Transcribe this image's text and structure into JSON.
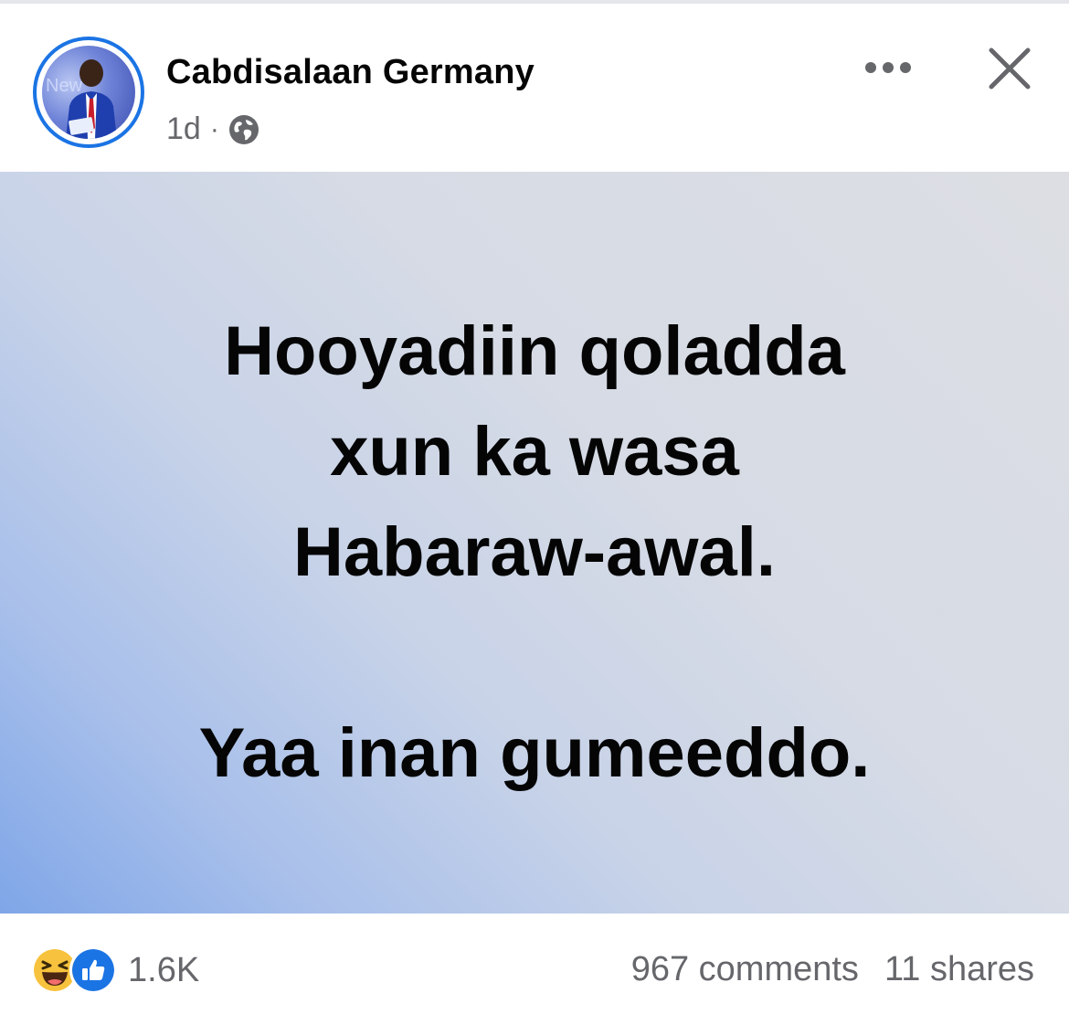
{
  "post": {
    "author": "Cabdisalaan Germany",
    "time": "1d",
    "separator": "·",
    "audience_icon": "globe-icon",
    "lines": [
      "Hooyadiin qoladda",
      "xun ka wasa",
      "Habaraw-awal.",
      "",
      "Yaa inan gumeeddo."
    ]
  },
  "footer": {
    "reaction_icons": [
      "haha-reaction-icon",
      "like-reaction-icon"
    ],
    "reaction_count": "1.6K",
    "comments": "967 comments",
    "shares": "11 shares"
  },
  "icons": {
    "more": "more-options-icon",
    "close": "close-icon"
  },
  "colors": {
    "accent": "#1b74e4",
    "secondary_text": "#65676b",
    "primary_text": "#050505"
  }
}
